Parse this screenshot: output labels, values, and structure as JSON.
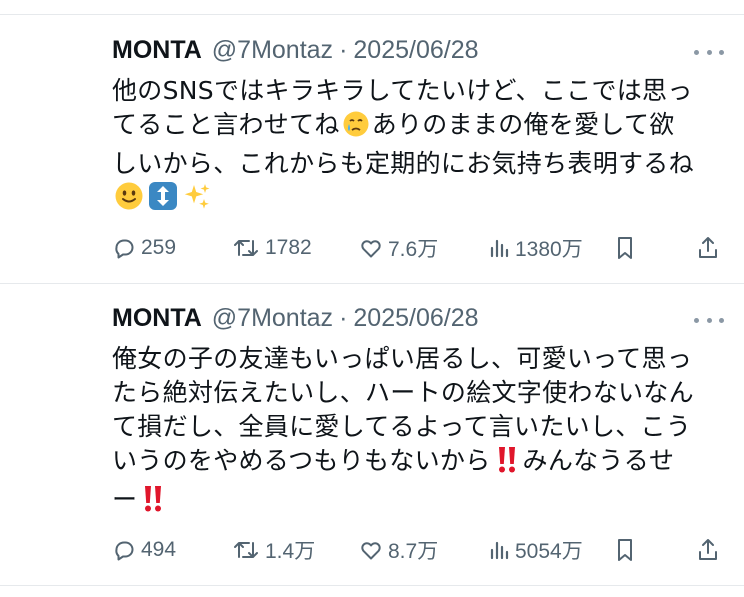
{
  "tweets": [
    {
      "author": "MONTA",
      "handle": "@7Montaz",
      "separator": "·",
      "date": "2025/06/28",
      "text_lines": [
        "他のSNSではキラキラしてたいけど、ここでは思っ",
        "てること言わせてね",
        "ありのままの俺を愛して欲",
        "しいから、これからも定期的にお気持ち表明するね"
      ],
      "emojis": [
        "crying-face-emoji",
        "slightly-smiling-face-emoji",
        "up-down-arrow-emoji",
        "sparkles-emoji"
      ],
      "replies": "259",
      "reposts": "1782",
      "likes": "7.6万",
      "views": "1380万"
    },
    {
      "author": "MONTA",
      "handle": "@7Montaz",
      "separator": "·",
      "date": "2025/06/28",
      "text_lines": [
        "俺女の子の友達もいっぱい居るし、可愛いって思っ",
        "たら絶対伝えたいし、ハートの絵文字使わないなん",
        "て損だし、全員に愛してるよって言いたいし、こう",
        "いうのをやめるつもりもないから",
        "みんなうるせ",
        "ー"
      ],
      "emojis": [
        "double-exclamation-emoji",
        "double-exclamation-emoji"
      ],
      "replies": "494",
      "reposts": "1.4万",
      "likes": "8.7万",
      "views": "5054万"
    }
  ],
  "colors": {
    "text": "#0f1419",
    "secondary": "#536471",
    "divider": "#e6e9ec",
    "exclamation": "#e0162b"
  }
}
